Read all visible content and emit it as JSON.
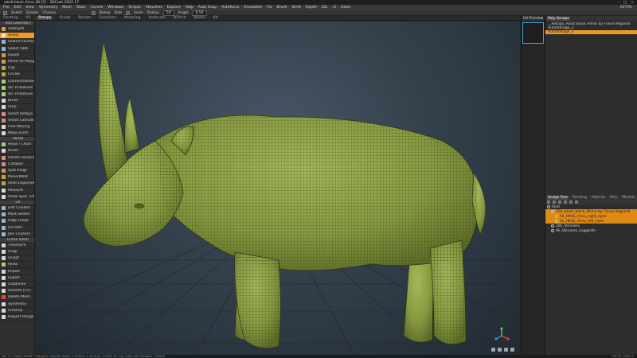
{
  "window": {
    "title": "adult black rhino.3B [2] - 3DCoat 2022.17",
    "controls": [
      "–",
      "□",
      "×"
    ]
  },
  "menu": {
    "items": [
      "File",
      "Edit",
      "View",
      "Symmetry",
      "Mesh",
      "Stats",
      "Curves",
      "Windows",
      "Scripts",
      "Vbrushes",
      "Explore",
      "Help",
      "Auto Snap",
      "Autofocus",
      "Emulation",
      "Fix",
      "Brush",
      "Sm%",
      "Depth",
      "LEL",
      "Cl",
      "Gloss"
    ],
    "right": "KEYMS"
  },
  "toolbar": {
    "items": [
      "Select",
      "Simple",
      "Choose",
      "Below",
      "Side",
      "Inner",
      "Radius",
      "50",
      "Angle",
      "0.50"
    ]
  },
  "room_tabs": {
    "items": [
      "Painting",
      "UV",
      "Retopo",
      "Sculpt",
      "Render",
      "Functions",
      "Modeling",
      "Voxbrush",
      "3DPrint",
      "Nodes",
      "Kit"
    ],
    "active": "Retopo"
  },
  "tools": [
    {
      "label": "Add Geometry",
      "type": "section"
    },
    {
      "label": "Add/Split",
      "color": "#c7a14a"
    },
    {
      "label": "Select",
      "color": "#e8e8e8",
      "active": true
    },
    {
      "label": "Select/Transform",
      "color": "#8fb7d8"
    },
    {
      "label": "Select Path",
      "color": "#8fb7d8"
    },
    {
      "label": "Quads",
      "color": "#c7a14a"
    },
    {
      "label": "Points to Polygons",
      "color": "#c7a14a"
    },
    {
      "label": "Cap",
      "color": "#c7a14a"
    },
    {
      "label": "Circles",
      "color": "#c7a14a"
    },
    {
      "label": "Connect/Slides",
      "color": "#9ed27a"
    },
    {
      "label": "Str. Primitives",
      "color": "#9ed27a"
    },
    {
      "label": "Str. Primitives",
      "color": "#9ed27a"
    },
    {
      "label": "Brush",
      "color": "#d8d8d8"
    },
    {
      "label": "Strip",
      "color": "#d8d8d8"
    },
    {
      "label": "Smart Retopo",
      "color": "#d88a8a"
    },
    {
      "label": "Smart Extrude",
      "color": "#d88a8a"
    },
    {
      "label": "Free Moving",
      "color": "#d8d8d8"
    },
    {
      "label": "Make Joints",
      "color": "#d8d8d8"
    },
    {
      "label": "Tweak",
      "type": "section"
    },
    {
      "label": "Relax / Clean",
      "color": "#9ed27a"
    },
    {
      "label": "Brush",
      "color": "#d8d8d8"
    },
    {
      "label": "Delete Face/Edge",
      "color": "#d88a8a"
    },
    {
      "label": "Collapse",
      "color": "#d88a8a"
    },
    {
      "label": "Split Rings",
      "color": "#c7a14a"
    },
    {
      "label": "Move/Weld",
      "color": "#c7a14a"
    },
    {
      "label": "Slide Edges/Vertex",
      "color": "#c7a14a"
    },
    {
      "label": "Measure",
      "color": "#d8d8d8"
    },
    {
      "label": "Show Spec. Edge",
      "color": "#d8d8d8"
    },
    {
      "label": "UV",
      "type": "section"
    },
    {
      "label": "Edit Clusters",
      "color": "#8fb7d8"
    },
    {
      "label": "Mark Seams",
      "color": "#8fb7d8"
    },
    {
      "label": "Edge Loops",
      "color": "#8fb7d8"
    },
    {
      "label": "UV Path",
      "color": "#8fb7d8"
    },
    {
      "label": "Join Clusters",
      "color": "#8fb7d8"
    },
    {
      "label": "Entire mesh",
      "type": "section"
    },
    {
      "label": "Transform",
      "color": "#d8d8d8"
    },
    {
      "label": "Snap",
      "color": "#d8d8d8"
    },
    {
      "label": "Sculpt",
      "color": "#d8d8d8"
    },
    {
      "label": "Relax",
      "color": "#9ed27a"
    },
    {
      "label": "Import",
      "color": "#d8d8d8"
    },
    {
      "label": "Export",
      "color": "#d8d8d8"
    },
    {
      "label": "Subdivide",
      "color": "#d8d8d8"
    },
    {
      "label": "Smooth (CC)",
      "color": "#d8d8d8"
    },
    {
      "label": "Delete Mesh",
      "color": "#e04a3a"
    },
    {
      "label": "Symmetry",
      "color": "#d8d8d8"
    },
    {
      "label": "Cleanup",
      "color": "#d8d8d8"
    },
    {
      "label": "Inspect Polygons",
      "color": "#d8d8d8"
    }
  ],
  "uv_preview": {
    "title": "UV Preview"
  },
  "poly_groups": {
    "tabs": [
      "Poly Groups"
    ],
    "rows": [
      {
        "label": "__Retopo_Adult Black Rhino by Flavio Regiardi",
        "selected": false
      },
      {
        "label": "AutoVoltage_2",
        "selected": false
      },
      {
        "label": "AutoVoltage_3",
        "selected": true
      }
    ]
  },
  "sculpt_tree": {
    "tabs": [
      "Sculpt Tree",
      "Painting",
      "Objects",
      "Poly",
      "Models"
    ],
    "active": "Sculpt Tree",
    "toolrow_label": "Root",
    "rows": [
      {
        "label": "25k_Adult_black_Rhino by Flavio Regiardi",
        "selected": true,
        "indent": 1
      },
      {
        "label": "5k_HIHG_rhino_right_eyes",
        "selected": true,
        "indent": 2
      },
      {
        "label": "5k_HIHG_rhino_left_eyes",
        "selected": true,
        "indent": 2
      },
      {
        "label": "18k_Volvaero",
        "selected": false,
        "indent": 1
      },
      {
        "label": "8k_Volvaero_LoggedIn",
        "selected": false,
        "indent": 1
      }
    ]
  },
  "status": {
    "left": "Res 1:1  Create 769KB T. Polygons: 28k/48  Visible: 7  N-Gons: 0  Vertices: 973424  Fix Log: mesh info  Triangles: 104528",
    "right": "FPS 50 | 2022.1"
  },
  "colors": {
    "accent": "#f29a1e",
    "rhino_fill": "#8a9c45",
    "wire": "#3b4a18",
    "grid": "#1f2329"
  },
  "icons": [
    "gizmo-axis-icon",
    "pan-icon",
    "rotate-icon",
    "zoom-icon",
    "camera-icon"
  ]
}
